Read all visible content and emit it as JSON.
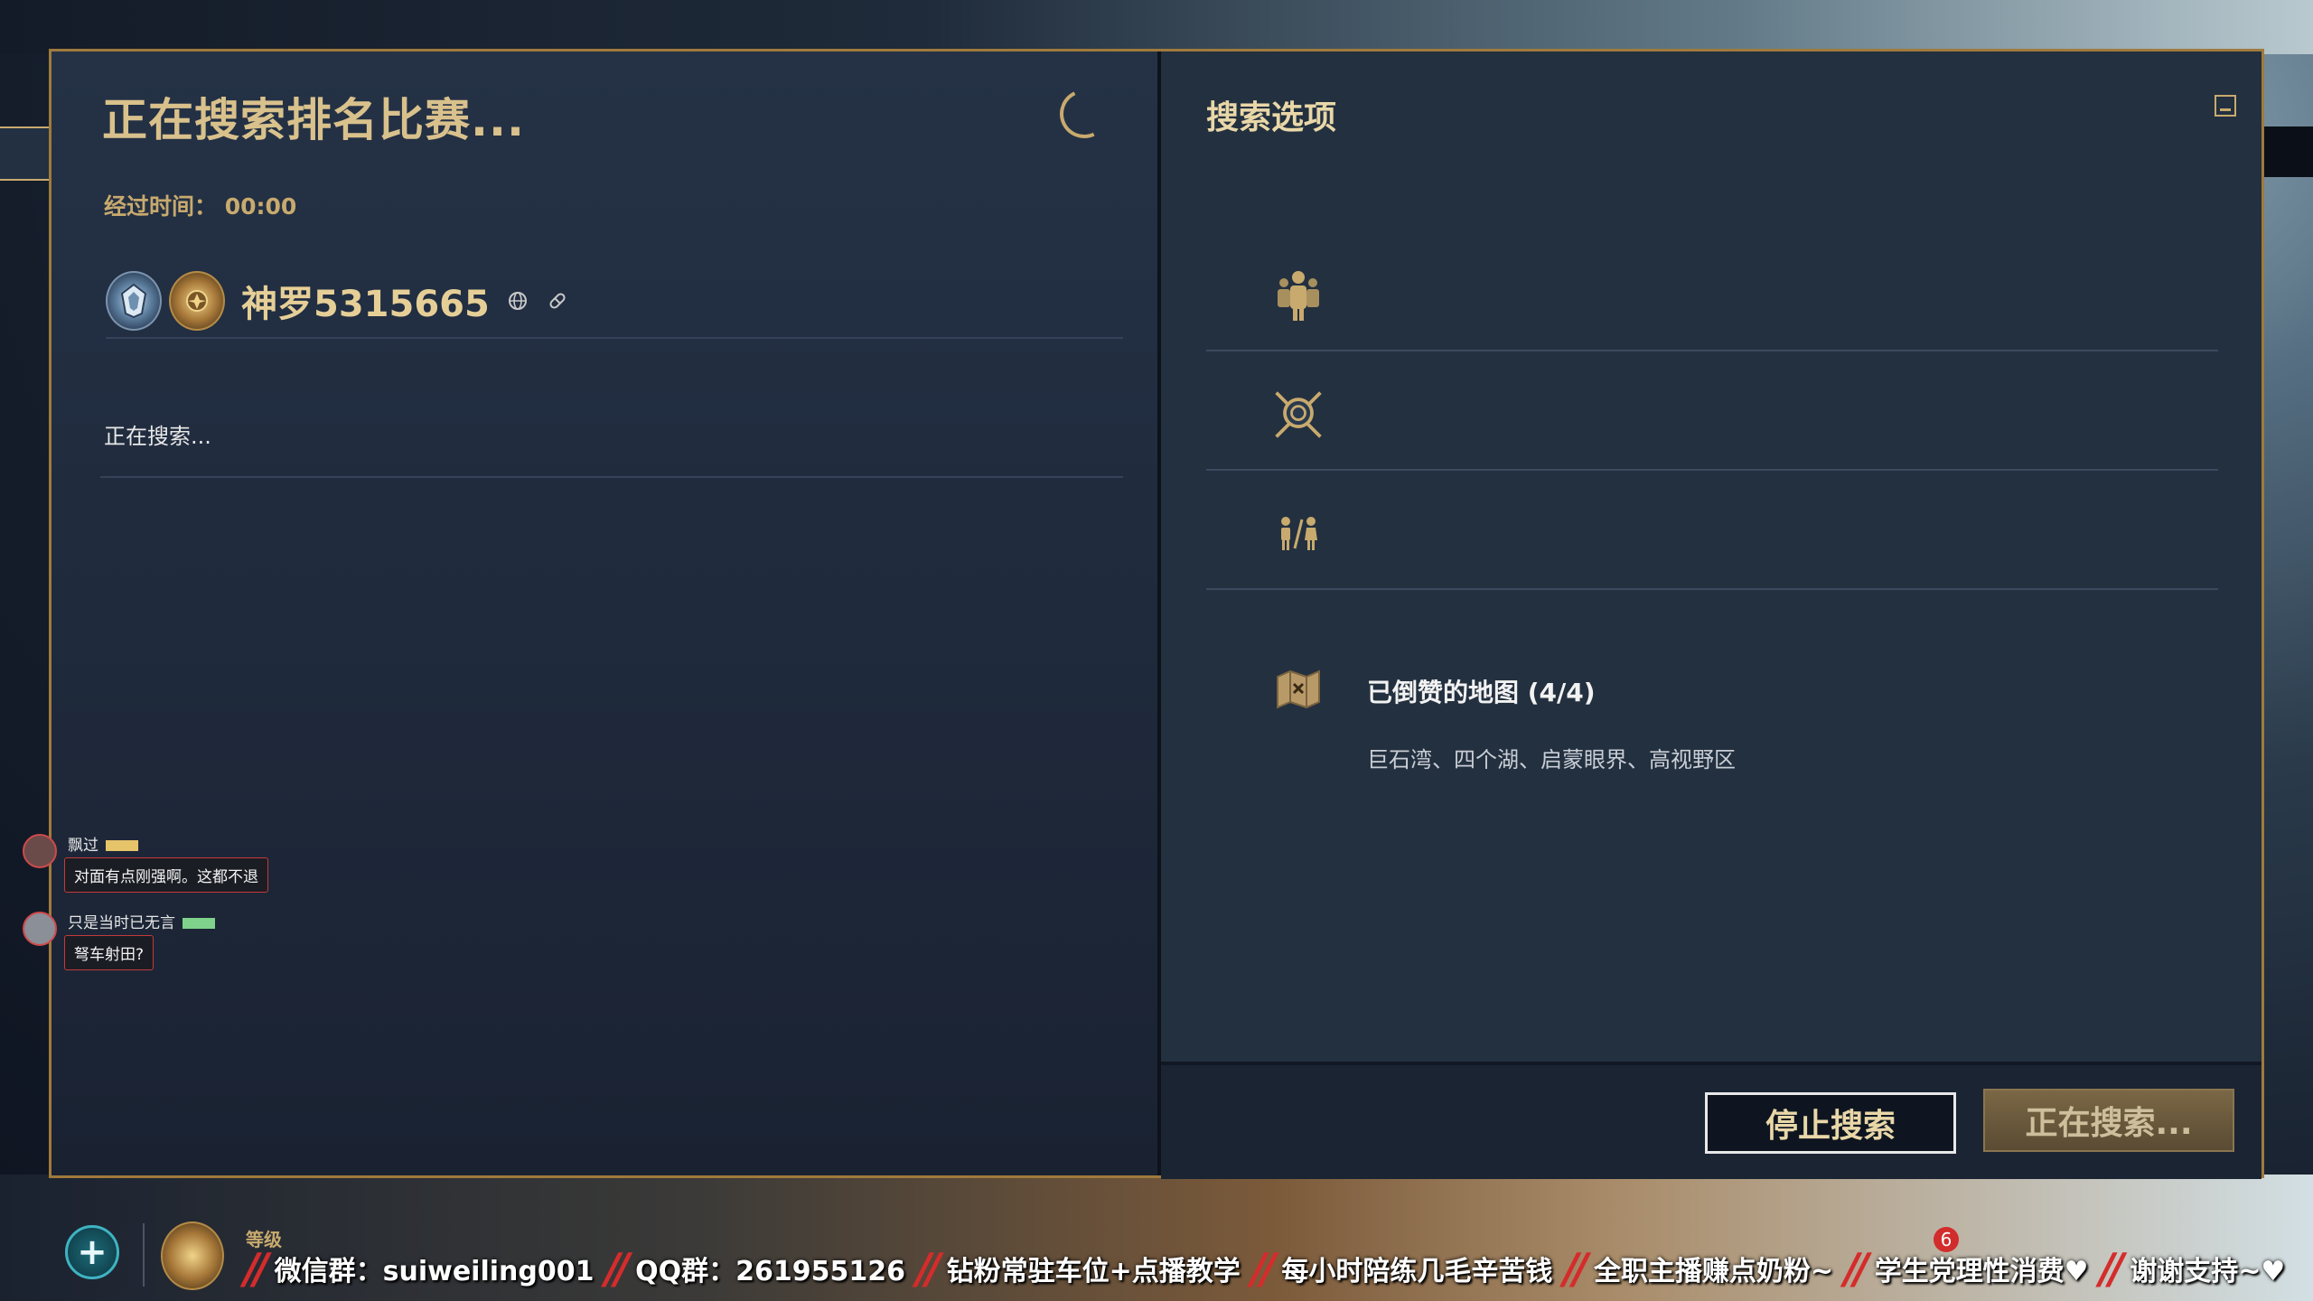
{
  "search": {
    "title": "正在搜索排名比赛...",
    "elapsed_label": "经过时间：",
    "elapsed_time": "00:00"
  },
  "player": {
    "name": "神罗5315665",
    "status": "正在搜索..."
  },
  "chat": [
    {
      "name": "飘过",
      "message": "对面有点刚强啊。这都不退"
    },
    {
      "name": "只是当时已无言",
      "message": "弩车射田?"
    }
  ],
  "options": {
    "title": "搜索选项",
    "rows": [
      {
        "icon": "group-icon"
      },
      {
        "icon": "crossed-swords-shield-icon"
      },
      {
        "icon": "gender-icon"
      }
    ],
    "maps": {
      "title": "已倒赞的地图 (4/4)",
      "list": "巨石湾、四个湖、启蒙眼界、高视野区"
    }
  },
  "buttons": {
    "stop": "停止搜索",
    "searching": "正在搜索..."
  },
  "bottom": {
    "level_label": "等级",
    "notification_count": "6",
    "marquee": [
      "微信群：suiweiling001",
      "QQ群：261955126",
      "钻粉常驻车位+点播教学",
      "每小时陪练几毛辛苦钱",
      "全职主播赚点奶粉~",
      "学生党理性消费♥",
      "谢谢支持~♥"
    ]
  },
  "colors": {
    "gold": "#c8aa6e",
    "panel_left": "#1f2a3c",
    "panel_right": "#23303f",
    "marquee_separator": "#d42c2c"
  }
}
